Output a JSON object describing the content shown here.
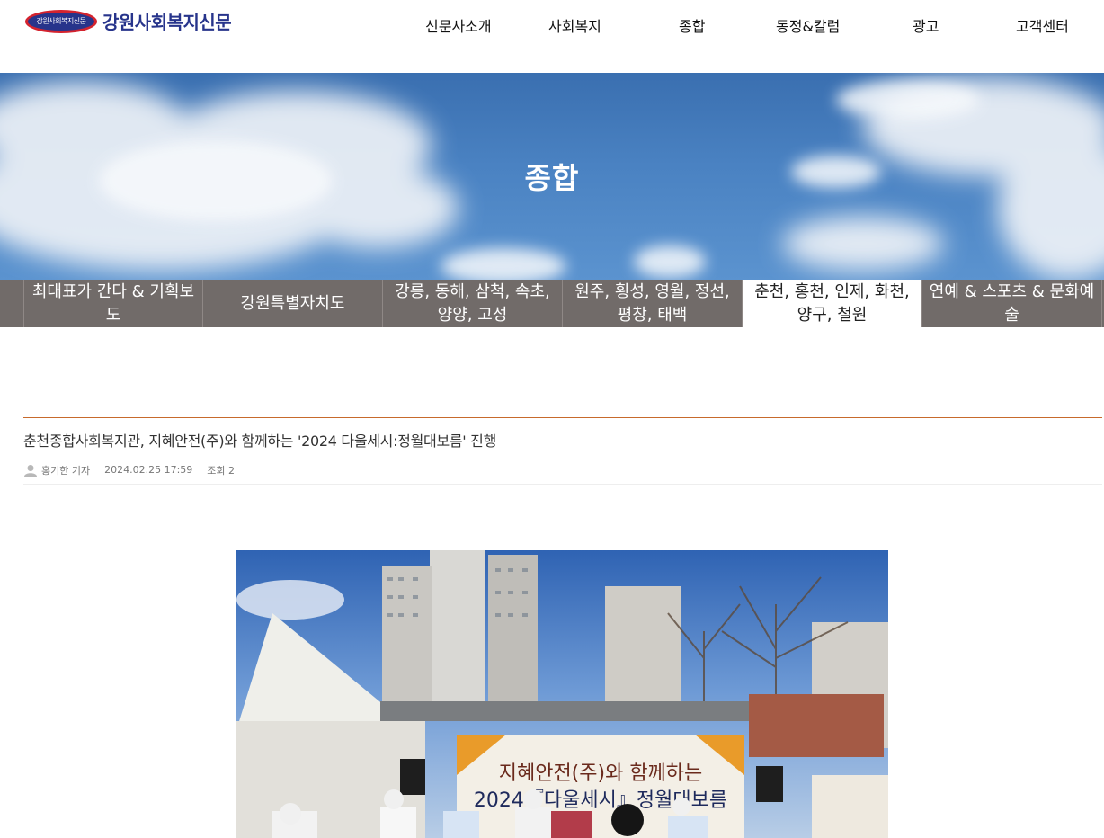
{
  "brand": {
    "name": "강원사회복지신문",
    "emblem_text": "강원사회복지신문",
    "color_primary": "#27348b",
    "color_accent": "#d4232e"
  },
  "nav": {
    "items": [
      {
        "label": "신문사소개"
      },
      {
        "label": "사회복지"
      },
      {
        "label": "종합"
      },
      {
        "label": "동정&칼럼"
      },
      {
        "label": "광고"
      },
      {
        "label": "고객센터"
      }
    ]
  },
  "hero": {
    "title": "종합"
  },
  "subnav": {
    "active_index": 4,
    "tabs": [
      {
        "label": "최대표가 간다 & 기획보도"
      },
      {
        "label": "강원특별자치도"
      },
      {
        "label": "강릉, 동해, 삼척, 속초, 양양, 고성"
      },
      {
        "label": "원주, 횡성, 영월, 정선, 평창, 태백"
      },
      {
        "label": "춘천, 홍천, 인제, 화천, 양구, 철원"
      },
      {
        "label": "연예 & 스포츠 & 문화예술"
      }
    ]
  },
  "article": {
    "title": "춘천종합사회복지관, 지혜안전(주)와 함께하는 '2024 다울세시:정월대보름' 진행",
    "author": "홍기한 기자",
    "date": "2024.02.25 17:59",
    "views": "조회 2",
    "photo": {
      "banner_line1": "지혜안전(주)와 함께하는",
      "banner_line2": "2024『다울세시』정월대보름"
    }
  },
  "icons": {
    "author_icon": "user-icon"
  }
}
